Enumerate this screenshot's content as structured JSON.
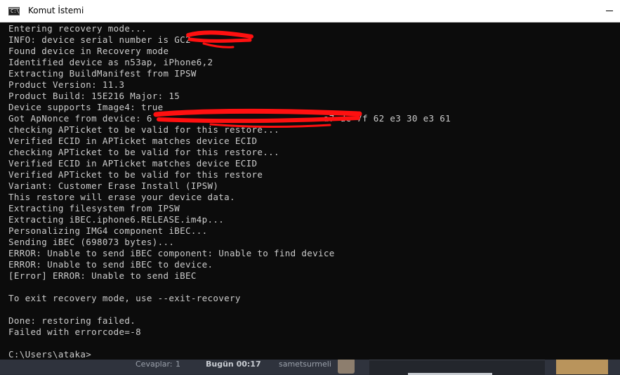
{
  "window": {
    "title": "Komut İstemi",
    "icon": "cmd-icon",
    "icon_label": "C:\\"
  },
  "console": {
    "lines": [
      "Entering recovery mode...",
      "INFO: device serial number is GC2",
      "Found device in Recovery mode",
      "Identified device as n53ap, iPhone6,2",
      "Extracting BuildManifest from IPSW",
      "Product Version: 11.3",
      "Product Build: 15E216 Major: 15",
      "Device supports Image4: true",
      "Got ApNonce from device: 6                               a7 dc 7f 62 e3 30 e3 61",
      "checking APTicket to be valid for this restore...",
      "Verified ECID in APTicket matches device ECID",
      "checking APTicket to be valid for this restore...",
      "Verified ECID in APTicket matches device ECID",
      "Verified APTicket to be valid for this restore",
      "Variant: Customer Erase Install (IPSW)",
      "This restore will erase your device data.",
      "Extracting filesystem from IPSW",
      "Extracting iBEC.iphone6.RELEASE.im4p...",
      "Personalizing IMG4 component iBEC...",
      "Sending iBEC (698073 bytes)...",
      "ERROR: Unable to send iBEC component: Unable to find device",
      "ERROR: Unable to send iBEC to device.",
      "[Error] ERROR: Unable to send iBEC",
      "",
      "To exit recovery mode, use --exit-recovery",
      "",
      "Done: restoring failed.",
      "Failed with errorcode=-8",
      "",
      "C:\\Users\\ataka>"
    ]
  },
  "background": {
    "left_letter": "m",
    "stats": {
      "replies_label": "Cevaplar:",
      "replies_value": "1",
      "time_label": "Bugün 00:17",
      "user": "sametsurmeli"
    }
  },
  "colors": {
    "console_bg": "#0c0c0c",
    "console_text": "#cccccc",
    "title_bar": "#ffffff",
    "redaction": "#ff1010"
  }
}
